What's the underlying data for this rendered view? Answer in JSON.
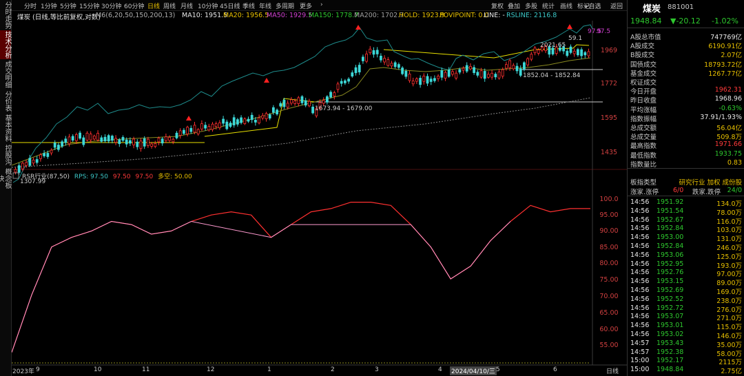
{
  "left_tabs": [
    "分时走势",
    "技术分析",
    "成交明细",
    "分价表",
    "基本资料",
    "控股沟",
    "概念板块"
  ],
  "toolbar": {
    "periods": [
      "分时",
      "1分钟",
      "5分钟",
      "15分钟",
      "30分钟",
      "60分钟",
      "日线",
      "周线",
      "月线",
      "10分钟",
      "45日线",
      "季线",
      "年线",
      "多周期",
      "更多"
    ],
    "active": "日线",
    "right_buttons": [
      "复权",
      "叠加",
      "多股",
      "统计",
      "画线",
      "标记",
      "+自选",
      "返回"
    ]
  },
  "info": {
    "name": "煤炭",
    "mode": "(日线,等比前复权,对数)",
    "ma_set": "M6(6,20,50,150,200,13)",
    "ma10": "MA10: 1951.5",
    "ma20": "MA20: 1956.5",
    "ma50": "MA50: 1929.5",
    "ma150": "MA150: 1778.7",
    "ma200": "MA200: 1702.7",
    "hold": "HOLD: 1923.9",
    "povipoint": "POVIPOINT: 0.0",
    "line": "LINE: -",
    "rsline": "RSLINE: 2116.8"
  },
  "price_axis": [
    "1969",
    "1772",
    "1595",
    "1435"
  ],
  "chart_labels": {
    "low": "1307.99",
    "box1": "1673.94 - 1679.00",
    "box2": "1852.04 - 1852.84",
    "high": "2021.65",
    "peak": "59.1",
    "rs_top": "97.5",
    "current_tag": "97.5"
  },
  "rs_header": {
    "name": "RSR行业(87,50)",
    "rps": "RPS: 97.50",
    "v2": "97.50",
    "v3": "97.50",
    "duo": "多空: 50.00"
  },
  "rs_axis": [
    "100.0",
    "95.00",
    "90.00",
    "85.00",
    "80.00",
    "75.00",
    "70.00",
    "65.00",
    "60.00",
    "55.00"
  ],
  "x_axis": [
    "2023年",
    "9",
    "10",
    "11",
    "12",
    "1",
    "2",
    "3",
    "4",
    "2024/04/10/三",
    "5",
    "6"
  ],
  "x_axis_right": "日线",
  "chart_data": {
    "type": "line",
    "series": [
      {
        "name": "RSR行业(87,50)",
        "values": [
          52,
          70,
          85,
          88,
          90,
          93,
          92,
          89,
          90,
          93,
          95,
          96,
          95,
          88,
          92,
          96,
          97,
          99,
          99,
          98,
          92,
          85,
          75,
          79,
          87,
          93,
          98,
          96,
          97,
          97
        ]
      }
    ],
    "ylim": [
      50,
      100
    ]
  },
  "panel": {
    "title": "煤炭",
    "code": "881001",
    "price": "1948.84",
    "change": "▼-20.12",
    "pct": "-1.02%",
    "rows": [
      {
        "label": "A股总市值",
        "value": "747769亿",
        "color": "white"
      },
      {
        "label": "A股成交",
        "value": "6190.91亿",
        "color": "yellow"
      },
      {
        "label": "B股成交",
        "value": "2.07亿",
        "color": "yellow"
      },
      {
        "label": "国债成交",
        "value": "18793.72亿",
        "color": "yellow"
      },
      {
        "label": "基金成交",
        "value": "1267.77亿",
        "color": "yellow"
      },
      {
        "label": "权证成交",
        "value": "",
        "color": "yellow"
      },
      {
        "label": "今日开盘",
        "value": "1962.31",
        "color": "red"
      },
      {
        "label": "昨日收盘",
        "value": "1968.96",
        "color": "white"
      },
      {
        "label": "平均涨幅",
        "value": "-0.63%",
        "color": "green"
      },
      {
        "label": "指数振幅",
        "value": "37.91/1.93%",
        "color": "white"
      },
      {
        "label": "总成交额",
        "value": "56.04亿",
        "color": "yellow"
      },
      {
        "label": "总成交量",
        "value": "509.8万",
        "color": "yellow"
      },
      {
        "label": "最高指数",
        "value": "1971.66",
        "color": "red"
      },
      {
        "label": "最低指数",
        "value": "1933.75",
        "color": "green"
      },
      {
        "label": "指数量比",
        "value": "0.83",
        "color": "yellow"
      }
    ],
    "type_row": {
      "label": "板指类型",
      "value": "研究行业 加权 成份股"
    },
    "updown": {
      "up_label": "涨家.涨停",
      "up_value": "6/0",
      "down_label": "跌家.跌停",
      "down_value": "24/0"
    },
    "ticks": [
      {
        "t": "14:56",
        "p": "1951.92",
        "v": "134.0万"
      },
      {
        "t": "14:56",
        "p": "1951.54",
        "v": "78.00万"
      },
      {
        "t": "14:56",
        "p": "1952.67",
        "v": "116.0万"
      },
      {
        "t": "14:56",
        "p": "1952.84",
        "v": "103.0万"
      },
      {
        "t": "14:56",
        "p": "1953.00",
        "v": "131.0万"
      },
      {
        "t": "14:56",
        "p": "1952.84",
        "v": "246.0万"
      },
      {
        "t": "14:56",
        "p": "1953.06",
        "v": "125.0万"
      },
      {
        "t": "14:56",
        "p": "1952.95",
        "v": "193.0万"
      },
      {
        "t": "14:56",
        "p": "1952.76",
        "v": "97.00万"
      },
      {
        "t": "14:56",
        "p": "1953.15",
        "v": "89.00万"
      },
      {
        "t": "14:56",
        "p": "1952.69",
        "v": "169.0万"
      },
      {
        "t": "14:56",
        "p": "1952.52",
        "v": "238.0万"
      },
      {
        "t": "14:56",
        "p": "1952.72",
        "v": "276.0万"
      },
      {
        "t": "14:56",
        "p": "1953.07",
        "v": "271.0万"
      },
      {
        "t": "14:56",
        "p": "1953.01",
        "v": "115.0万"
      },
      {
        "t": "14:56",
        "p": "1953.02",
        "v": "146.0万"
      },
      {
        "t": "14:57",
        "p": "1953.43",
        "v": "35.00万"
      },
      {
        "t": "14:57",
        "p": "1952.38",
        "v": "58.00万"
      },
      {
        "t": "15:00",
        "p": "1952.17",
        "v": "2115万"
      },
      {
        "t": "15:00",
        "p": "1948.84",
        "v": "2.75亿"
      }
    ]
  }
}
